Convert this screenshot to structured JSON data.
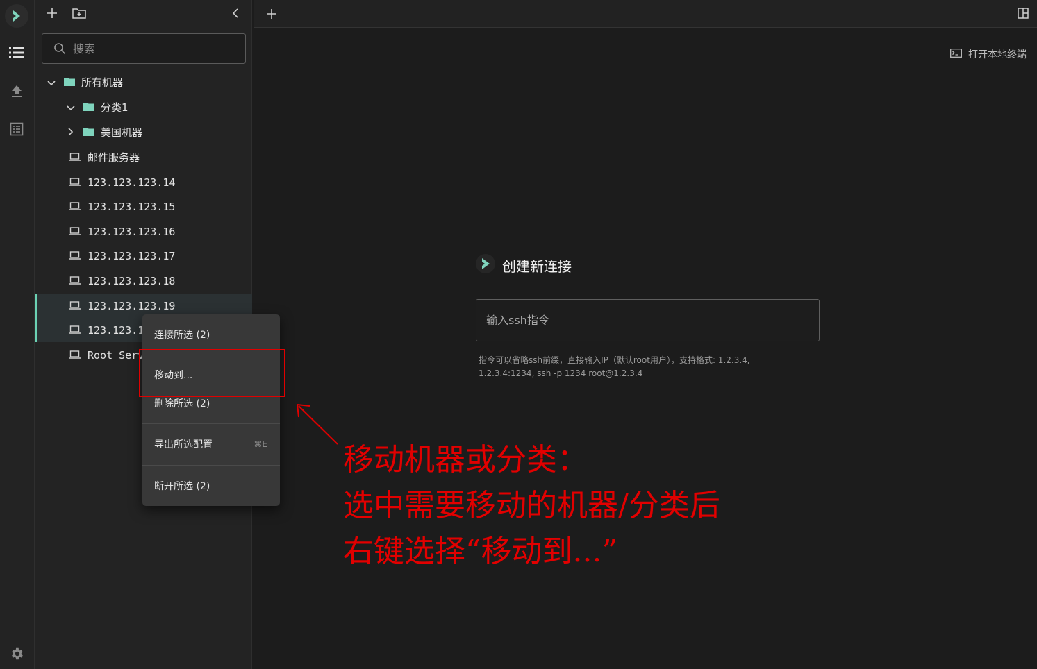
{
  "sidebar": {
    "search_placeholder": "搜索",
    "tree": [
      {
        "label": "所有机器",
        "kind": "folder",
        "expanded": true
      },
      {
        "label": "分类1",
        "kind": "folder",
        "expanded": true
      },
      {
        "label": "美国机器",
        "kind": "folder",
        "expanded": false
      },
      {
        "label": "邮件服务器",
        "kind": "server"
      },
      {
        "label": "123.123.123.14",
        "kind": "server"
      },
      {
        "label": "123.123.123.15",
        "kind": "server"
      },
      {
        "label": "123.123.123.16",
        "kind": "server"
      },
      {
        "label": "123.123.123.17",
        "kind": "server"
      },
      {
        "label": "123.123.123.18",
        "kind": "server"
      },
      {
        "label": "123.123.123.19",
        "kind": "server",
        "selected": true
      },
      {
        "label": "123.123.1",
        "kind": "server",
        "selected": true
      },
      {
        "label": "Root Serv",
        "kind": "server"
      }
    ]
  },
  "main": {
    "open_terminal": "打开本地终端",
    "new_connection_title": "创建新连接",
    "ssh_placeholder": "输入ssh指令",
    "hint_line1": "指令可以省略ssh前缀，直接输入IP（默认root用户），支持格式: 1.2.3.4,",
    "hint_line2": "1.2.3.4:1234, ssh -p 1234 root@1.2.3.4"
  },
  "context_menu": {
    "connect": "连接所选 (2)",
    "move": "移动到...",
    "delete": "删除所选 (2)",
    "export": "导出所选配置",
    "export_shortcut": "⌘E",
    "disconnect": "断开所选 (2)"
  },
  "annotation": {
    "line1": "移动机器或分类：",
    "line2": "选中需要移动的机器/分类后",
    "line3": "右键选择“移动到...”"
  },
  "colors": {
    "accent": "#6bd1b3",
    "folder": "#7fd4bd",
    "annotation": "#e20000"
  }
}
